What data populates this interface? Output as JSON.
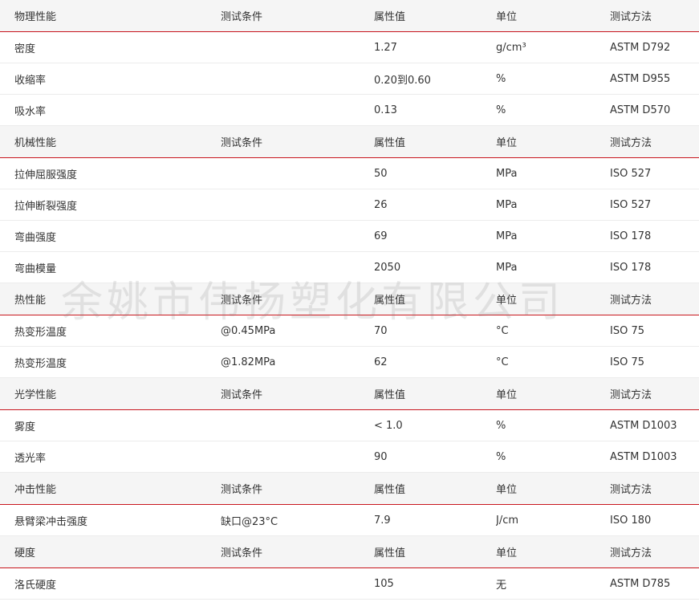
{
  "watermark": "余姚市伟扬塑化有限公司",
  "colors": {
    "header_background": "#f5f5f5",
    "header_divider": "#c8161d",
    "row_divider": "#ececec",
    "text": "#333333"
  },
  "sections": [
    {
      "header": [
        "物理性能",
        "测试条件",
        "属性值",
        "单位",
        "测试方法"
      ],
      "rows": [
        [
          "密度",
          "",
          "1.27",
          "g/cm³",
          "ASTM D792"
        ],
        [
          "收缩率",
          "",
          "0.20到0.60",
          "%",
          "ASTM D955"
        ],
        [
          "吸水率",
          "",
          "0.13",
          "%",
          "ASTM D570"
        ]
      ]
    },
    {
      "header": [
        "机械性能",
        "测试条件",
        "属性值",
        "单位",
        "测试方法"
      ],
      "rows": [
        [
          "拉伸屈服强度",
          "",
          "50",
          "MPa",
          "ISO 527"
        ],
        [
          "拉伸断裂强度",
          "",
          "26",
          "MPa",
          "ISO 527"
        ],
        [
          "弯曲强度",
          "",
          "69",
          "MPa",
          "ISO 178"
        ],
        [
          "弯曲模量",
          "",
          "2050",
          "MPa",
          "ISO 178"
        ]
      ]
    },
    {
      "header": [
        "热性能",
        "测试条件",
        "属性值",
        "单位",
        "测试方法"
      ],
      "rows": [
        [
          "热变形温度",
          "@0.45MPa",
          "70",
          "°C",
          "ISO 75"
        ],
        [
          "热变形温度",
          "@1.82MPa",
          "62",
          "°C",
          "ISO 75"
        ]
      ]
    },
    {
      "header": [
        "光学性能",
        "测试条件",
        "属性值",
        "单位",
        "测试方法"
      ],
      "rows": [
        [
          "雾度",
          "",
          "< 1.0",
          "%",
          "ASTM D1003"
        ],
        [
          "透光率",
          "",
          "90",
          "%",
          "ASTM D1003"
        ]
      ]
    },
    {
      "header": [
        "冲击性能",
        "测试条件",
        "属性值",
        "单位",
        "测试方法"
      ],
      "rows": [
        [
          "悬臂梁冲击强度",
          "缺口@23°C",
          "7.9",
          "J/cm",
          "ISO 180"
        ]
      ]
    },
    {
      "header": [
        "硬度",
        "测试条件",
        "属性值",
        "单位",
        "测试方法"
      ],
      "rows": [
        [
          "洛氏硬度",
          "",
          "105",
          "无",
          "ASTM D785"
        ]
      ]
    }
  ]
}
